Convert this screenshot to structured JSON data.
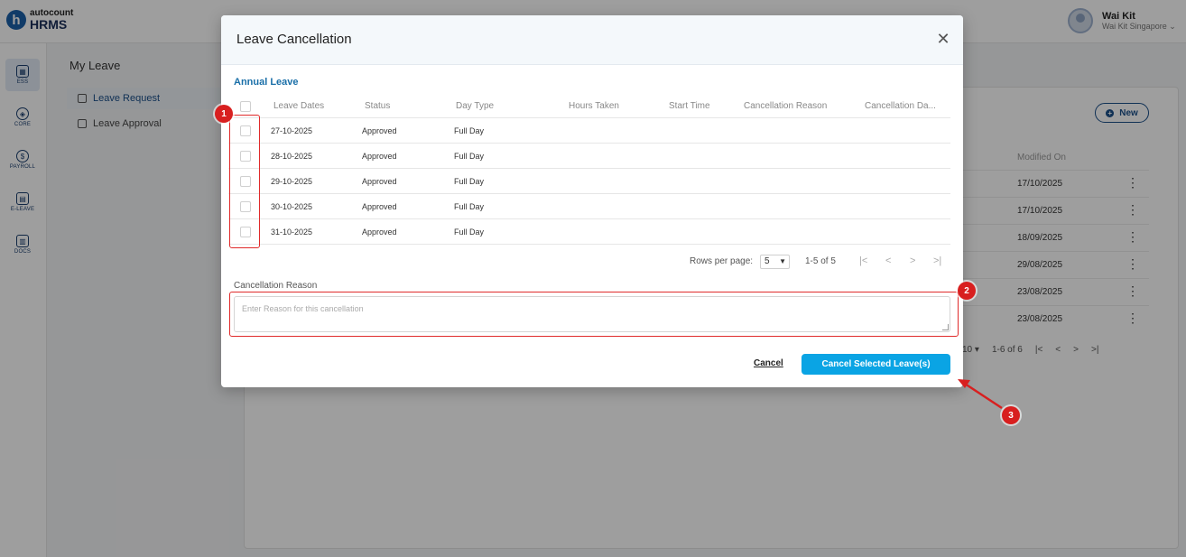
{
  "brand": {
    "top": "autocount",
    "bottom": "HRMS",
    "mark": "h"
  },
  "user": {
    "name": "Wai Kit",
    "org": "Wai Kit Singapore"
  },
  "sidebar": {
    "items": [
      {
        "label": "ESS",
        "icon": "ess-icon"
      },
      {
        "label": "CORE",
        "icon": "core-icon"
      },
      {
        "label": "PAYROLL",
        "icon": "payroll-icon"
      },
      {
        "label": "E-LEAVE",
        "icon": "calendar-icon"
      },
      {
        "label": "DOCS",
        "icon": "docs-icon"
      }
    ]
  },
  "page": {
    "title": "My Leave",
    "subnav": [
      "Leave Request",
      "Leave Approval"
    ]
  },
  "background": {
    "new_label": "New",
    "modified_header": "Modified On",
    "modified_dates": [
      "17/10/2025",
      "17/10/2025",
      "18/09/2025",
      "29/08/2025",
      "23/08/2025",
      "23/08/2025"
    ],
    "pager_fragment": "10",
    "pager_range": "1-6 of 6"
  },
  "dialog": {
    "title": "Leave Cancellation",
    "section": "Annual Leave",
    "columns": [
      "Leave Dates",
      "Status",
      "Day Type",
      "Hours Taken",
      "Start Time",
      "Cancellation Reason",
      "Cancellation Da..."
    ],
    "rows": [
      {
        "date": "27-10-2025",
        "status": "Approved",
        "day_type": "Full Day"
      },
      {
        "date": "28-10-2025",
        "status": "Approved",
        "day_type": "Full Day"
      },
      {
        "date": "29-10-2025",
        "status": "Approved",
        "day_type": "Full Day"
      },
      {
        "date": "30-10-2025",
        "status": "Approved",
        "day_type": "Full Day"
      },
      {
        "date": "31-10-2025",
        "status": "Approved",
        "day_type": "Full Day"
      }
    ],
    "pagination": {
      "rows_per_page_label": "Rows per page:",
      "rows_per_page": "5",
      "range": "1-5 of 5"
    },
    "reason": {
      "label": "Cancellation Reason",
      "placeholder": "Enter Reason for this cancellation",
      "value": ""
    },
    "cancel_label": "Cancel",
    "submit_label": "Cancel Selected Leave(s)"
  },
  "annotations": [
    "1",
    "2",
    "3"
  ],
  "colors": {
    "accent": "#0aa4e4",
    "annotation": "#d81f1f",
    "section_title": "#1a6fa8"
  }
}
